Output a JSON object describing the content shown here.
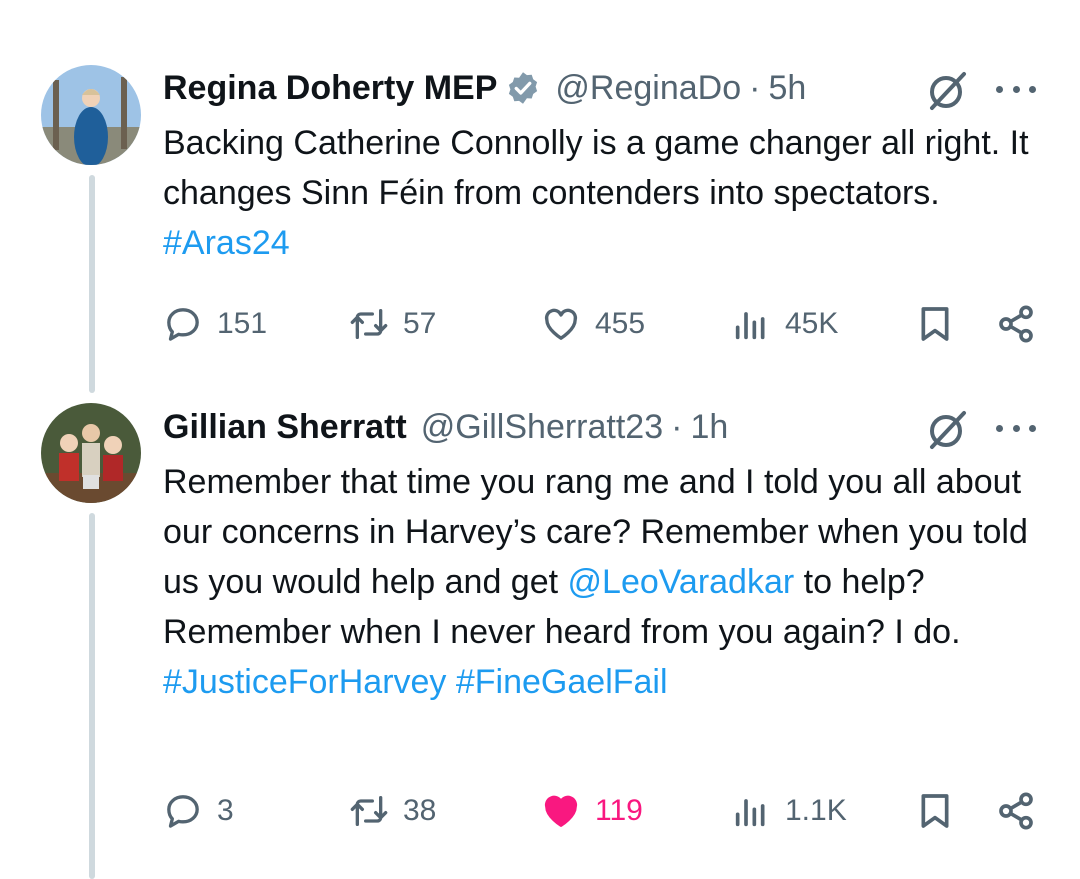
{
  "tweets": [
    {
      "name": "Regina Doherty MEP",
      "handle": "@ReginaDo",
      "dot": "·",
      "time": "5h",
      "text_parts": [
        "Backing Catherine Connolly is a game changer all right. It changes Sinn Féin from contenders into spectators. ",
        "#Aras24"
      ],
      "replies": "151",
      "reposts": "57",
      "likes": "455",
      "views": "45K",
      "liked": false
    },
    {
      "name": "Gillian Sherratt",
      "handle": "@GillSherratt23",
      "dot": "·",
      "time": "1h",
      "text_parts": [
        "Remember that time you rang me and I told you all about our concerns in Harvey’s care? Remember when you told us you would help and get ",
        "@LeoVaradkar",
        " to help? Remember when I never heard from you again? I do. ",
        "#JusticeForHarvey",
        " ",
        "#FineGaelFail"
      ],
      "replies": "3",
      "reposts": "38",
      "likes": "119",
      "views": "1.1K",
      "liked": true
    }
  ],
  "colors": {
    "link": "#1d9bf0",
    "secondary": "#536471",
    "like": "#f91880",
    "verified": "#829aab"
  },
  "icons": [
    "verified-badge-icon",
    "grok-icon",
    "more-icon",
    "reply-icon",
    "repost-icon",
    "like-icon",
    "views-icon",
    "bookmark-icon",
    "share-icon"
  ]
}
